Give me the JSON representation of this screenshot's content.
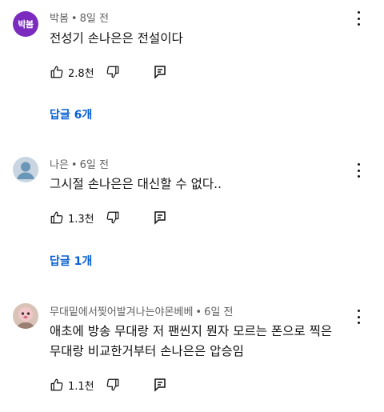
{
  "comments": [
    {
      "avatar_text": "박봄",
      "avatar_color": "#7b2cbf",
      "author": "박봄",
      "time": "8일 전",
      "lines": [
        "전성기 손나은은 전설이다"
      ],
      "likes": "2.8천",
      "replies_label": "답글 6개"
    },
    {
      "avatar_text": "",
      "avatar_color": "#d3d9e0",
      "author": "나은",
      "time": "6일 전",
      "lines": [
        "그시절 손나은은 대신할 수 없다.."
      ],
      "likes": "1.3천",
      "replies_label": "답글 1개"
    },
    {
      "avatar_text": "",
      "avatar_color": "#e9d4c8",
      "author": "무대밑에서찢어발겨나는야몬베베",
      "time": "6일 전",
      "lines": [
        "애초에 방송 무대랑 저 팬씬지 뭔자 모르는 폰으로 찍은",
        "무대랑 비교한거부터 손나은은 압승임"
      ],
      "likes": "1.1천",
      "replies_label": ""
    }
  ],
  "icons": {
    "like": "thumbs-up-icon",
    "dislike": "thumbs-down-icon",
    "reply": "reply-comment-icon",
    "menu": "more-vert-icon"
  },
  "colors": {
    "link": "#065fd4",
    "meta": "#606060",
    "text": "#0f0f0f"
  }
}
